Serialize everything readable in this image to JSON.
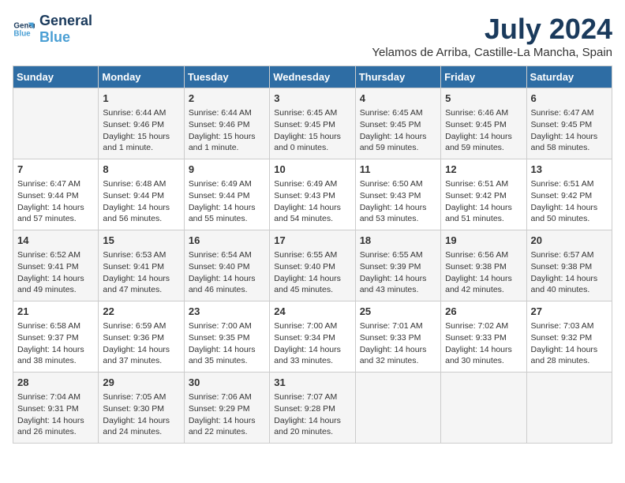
{
  "logo": {
    "line1": "General",
    "line2": "Blue"
  },
  "title": "July 2024",
  "location": "Yelamos de Arriba, Castille-La Mancha, Spain",
  "days_of_week": [
    "Sunday",
    "Monday",
    "Tuesday",
    "Wednesday",
    "Thursday",
    "Friday",
    "Saturday"
  ],
  "weeks": [
    [
      {
        "day": "",
        "info": ""
      },
      {
        "day": "1",
        "info": "Sunrise: 6:44 AM\nSunset: 9:46 PM\nDaylight: 15 hours\nand 1 minute."
      },
      {
        "day": "2",
        "info": "Sunrise: 6:44 AM\nSunset: 9:46 PM\nDaylight: 15 hours\nand 1 minute."
      },
      {
        "day": "3",
        "info": "Sunrise: 6:45 AM\nSunset: 9:45 PM\nDaylight: 15 hours\nand 0 minutes."
      },
      {
        "day": "4",
        "info": "Sunrise: 6:45 AM\nSunset: 9:45 PM\nDaylight: 14 hours\nand 59 minutes."
      },
      {
        "day": "5",
        "info": "Sunrise: 6:46 AM\nSunset: 9:45 PM\nDaylight: 14 hours\nand 59 minutes."
      },
      {
        "day": "6",
        "info": "Sunrise: 6:47 AM\nSunset: 9:45 PM\nDaylight: 14 hours\nand 58 minutes."
      }
    ],
    [
      {
        "day": "7",
        "info": "Sunrise: 6:47 AM\nSunset: 9:44 PM\nDaylight: 14 hours\nand 57 minutes."
      },
      {
        "day": "8",
        "info": "Sunrise: 6:48 AM\nSunset: 9:44 PM\nDaylight: 14 hours\nand 56 minutes."
      },
      {
        "day": "9",
        "info": "Sunrise: 6:49 AM\nSunset: 9:44 PM\nDaylight: 14 hours\nand 55 minutes."
      },
      {
        "day": "10",
        "info": "Sunrise: 6:49 AM\nSunset: 9:43 PM\nDaylight: 14 hours\nand 54 minutes."
      },
      {
        "day": "11",
        "info": "Sunrise: 6:50 AM\nSunset: 9:43 PM\nDaylight: 14 hours\nand 53 minutes."
      },
      {
        "day": "12",
        "info": "Sunrise: 6:51 AM\nSunset: 9:42 PM\nDaylight: 14 hours\nand 51 minutes."
      },
      {
        "day": "13",
        "info": "Sunrise: 6:51 AM\nSunset: 9:42 PM\nDaylight: 14 hours\nand 50 minutes."
      }
    ],
    [
      {
        "day": "14",
        "info": "Sunrise: 6:52 AM\nSunset: 9:41 PM\nDaylight: 14 hours\nand 49 minutes."
      },
      {
        "day": "15",
        "info": "Sunrise: 6:53 AM\nSunset: 9:41 PM\nDaylight: 14 hours\nand 47 minutes."
      },
      {
        "day": "16",
        "info": "Sunrise: 6:54 AM\nSunset: 9:40 PM\nDaylight: 14 hours\nand 46 minutes."
      },
      {
        "day": "17",
        "info": "Sunrise: 6:55 AM\nSunset: 9:40 PM\nDaylight: 14 hours\nand 45 minutes."
      },
      {
        "day": "18",
        "info": "Sunrise: 6:55 AM\nSunset: 9:39 PM\nDaylight: 14 hours\nand 43 minutes."
      },
      {
        "day": "19",
        "info": "Sunrise: 6:56 AM\nSunset: 9:38 PM\nDaylight: 14 hours\nand 42 minutes."
      },
      {
        "day": "20",
        "info": "Sunrise: 6:57 AM\nSunset: 9:38 PM\nDaylight: 14 hours\nand 40 minutes."
      }
    ],
    [
      {
        "day": "21",
        "info": "Sunrise: 6:58 AM\nSunset: 9:37 PM\nDaylight: 14 hours\nand 38 minutes."
      },
      {
        "day": "22",
        "info": "Sunrise: 6:59 AM\nSunset: 9:36 PM\nDaylight: 14 hours\nand 37 minutes."
      },
      {
        "day": "23",
        "info": "Sunrise: 7:00 AM\nSunset: 9:35 PM\nDaylight: 14 hours\nand 35 minutes."
      },
      {
        "day": "24",
        "info": "Sunrise: 7:00 AM\nSunset: 9:34 PM\nDaylight: 14 hours\nand 33 minutes."
      },
      {
        "day": "25",
        "info": "Sunrise: 7:01 AM\nSunset: 9:33 PM\nDaylight: 14 hours\nand 32 minutes."
      },
      {
        "day": "26",
        "info": "Sunrise: 7:02 AM\nSunset: 9:33 PM\nDaylight: 14 hours\nand 30 minutes."
      },
      {
        "day": "27",
        "info": "Sunrise: 7:03 AM\nSunset: 9:32 PM\nDaylight: 14 hours\nand 28 minutes."
      }
    ],
    [
      {
        "day": "28",
        "info": "Sunrise: 7:04 AM\nSunset: 9:31 PM\nDaylight: 14 hours\nand 26 minutes."
      },
      {
        "day": "29",
        "info": "Sunrise: 7:05 AM\nSunset: 9:30 PM\nDaylight: 14 hours\nand 24 minutes."
      },
      {
        "day": "30",
        "info": "Sunrise: 7:06 AM\nSunset: 9:29 PM\nDaylight: 14 hours\nand 22 minutes."
      },
      {
        "day": "31",
        "info": "Sunrise: 7:07 AM\nSunset: 9:28 PM\nDaylight: 14 hours\nand 20 minutes."
      },
      {
        "day": "",
        "info": ""
      },
      {
        "day": "",
        "info": ""
      },
      {
        "day": "",
        "info": ""
      }
    ]
  ]
}
